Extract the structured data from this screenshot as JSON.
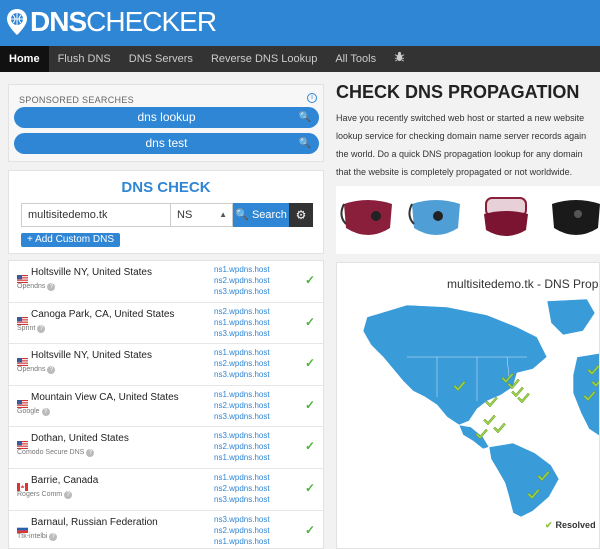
{
  "header": {
    "logo_text_bold": "DNS",
    "logo_text_thin": "CHECKER",
    "logo_icon": "location-pin-icon"
  },
  "nav": {
    "items": [
      "Home",
      "Flush DNS",
      "DNS Servers",
      "Reverse DNS Lookup",
      "All Tools"
    ],
    "active_index": 0,
    "extra_icon": "bug-icon"
  },
  "sponsored": {
    "title": "SPONSORED SEARCHES",
    "items": [
      "dns lookup",
      "dns test"
    ]
  },
  "dns_check": {
    "title": "DNS CHECK",
    "domain_value": "multisitedemo.tk",
    "record_type": "NS",
    "search_label": "Search",
    "add_custom_label": "+ Add Custom DNS"
  },
  "results": [
    {
      "location": "Holtsville NY, United States",
      "provider": "Opendns",
      "flag": "us",
      "ns": [
        "ns1.wpdns.host",
        "ns2.wpdns.host",
        "ns3.wpdns.host"
      ]
    },
    {
      "location": "Canoga Park, CA, United States",
      "provider": "Sprint",
      "flag": "us",
      "ns": [
        "ns2.wpdns.host",
        "ns1.wpdns.host",
        "ns3.wpdns.host"
      ]
    },
    {
      "location": "Holtsville NY, United States",
      "provider": "Opendns",
      "flag": "us",
      "ns": [
        "ns1.wpdns.host",
        "ns2.wpdns.host",
        "ns3.wpdns.host"
      ]
    },
    {
      "location": "Mountain View CA, United States",
      "provider": "Google",
      "flag": "us",
      "ns": [
        "ns1.wpdns.host",
        "ns2.wpdns.host",
        "ns3.wpdns.host"
      ]
    },
    {
      "location": "Dothan, United States",
      "provider": "Comodo Secure DNS",
      "flag": "us",
      "ns": [
        "ns3.wpdns.host",
        "ns2.wpdns.host",
        "ns1.wpdns.host"
      ]
    },
    {
      "location": "Barrie, Canada",
      "provider": "Rogers Comm",
      "flag": "ca",
      "ns": [
        "ns1.wpdns.host",
        "ns2.wpdns.host",
        "ns3.wpdns.host"
      ]
    },
    {
      "location": "Barnaul, Russian Federation",
      "provider": "Ttk-intelbi",
      "flag": "ru",
      "ns": [
        "ns3.wpdns.host",
        "ns2.wpdns.host",
        "ns1.wpdns.host"
      ]
    }
  ],
  "main": {
    "title": "CHECK DNS PROPAGATION",
    "desc_lines": [
      "Have you recently switched web host or started a new website",
      "lookup service for checking domain name server records again",
      "the world. Do a quick DNS propagation lookup for any domain",
      "that the website is completely propagated or not worldwide."
    ],
    "map_title": "multisitedemo.tk - DNS Prop",
    "legend_label": "Resolved"
  },
  "colors": {
    "brand_blue": "#2f86d4",
    "nav_dark": "#333333",
    "check_green": "#4db33d",
    "map_land": "#3a9bd9"
  }
}
